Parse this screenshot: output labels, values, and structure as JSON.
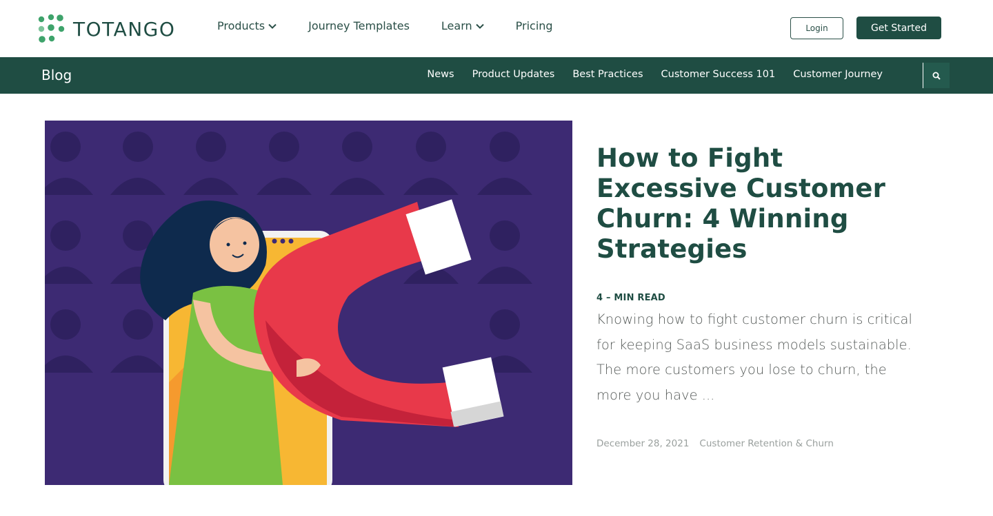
{
  "header": {
    "logo_text": "TOTANGO",
    "nav": [
      {
        "label": "Products",
        "has_dropdown": true
      },
      {
        "label": "Journey Templates",
        "has_dropdown": false
      },
      {
        "label": "Learn",
        "has_dropdown": true
      },
      {
        "label": "Pricing",
        "has_dropdown": false
      }
    ],
    "login_label": "Login",
    "get_started_label": "Get Started"
  },
  "blogbar": {
    "title": "Blog",
    "nav": [
      "News",
      "Product Updates",
      "Best Practices",
      "Customer Success 101",
      "Customer Journey"
    ],
    "search_icon": "search-icon"
  },
  "article": {
    "title": "How to Fight Excessive Customer Churn: 4 Winning Strategies",
    "read_time": "4 – MIN READ",
    "excerpt": "Knowing how to fight customer churn is critical for keeping SaaS business models sustainable. The more customers you lose to churn, the more you have ...",
    "date": "December 28, 2021",
    "category": "Customer Retention & Churn"
  },
  "colors": {
    "brand_dark_green": "#1f4d43",
    "logo_green": "#3ea36b",
    "hero_bg": "#3d2a73",
    "magnet_red": "#e8394a"
  }
}
